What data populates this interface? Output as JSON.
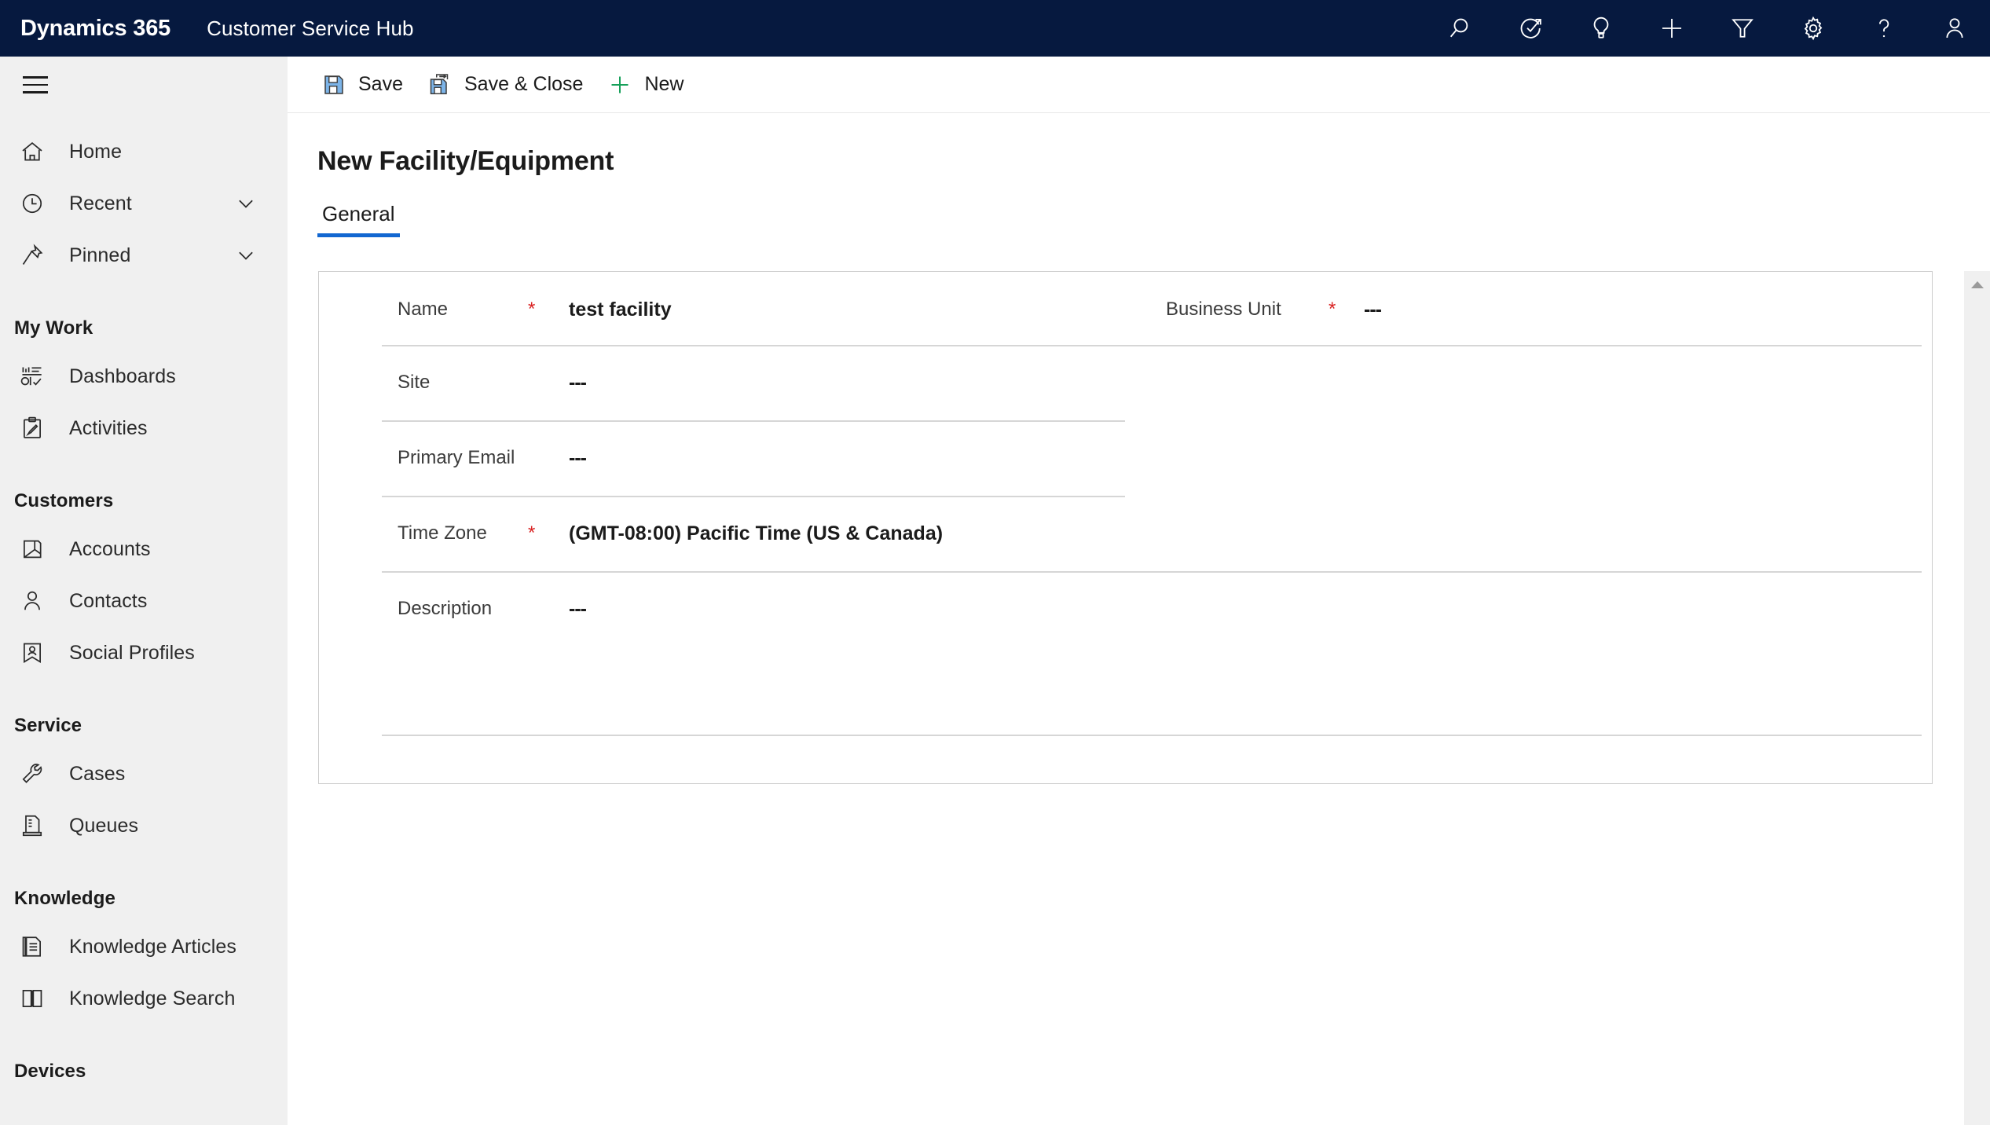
{
  "topbar": {
    "brand": "Dynamics 365",
    "app_name": "Customer Service Hub",
    "background_color": "#06193f",
    "icons": [
      {
        "name": "search-icon",
        "label": "Search"
      },
      {
        "name": "assistant-icon",
        "label": "Assistant"
      },
      {
        "name": "lightbulb-icon",
        "label": "Insights"
      },
      {
        "name": "plus-icon",
        "label": "Quick Create"
      },
      {
        "name": "filter-icon",
        "label": "Filter"
      },
      {
        "name": "gear-icon",
        "label": "Settings"
      },
      {
        "name": "help-icon",
        "label": "Help"
      },
      {
        "name": "user-icon",
        "label": "Account Manager"
      }
    ]
  },
  "sidebar": {
    "background_color": "#f0f0f0",
    "top_items": [
      {
        "label": "Home",
        "icon": "home-icon",
        "chevron": false
      },
      {
        "label": "Recent",
        "icon": "clock-icon",
        "chevron": true
      },
      {
        "label": "Pinned",
        "icon": "pin-icon",
        "chevron": true
      }
    ],
    "groups": [
      {
        "title": "My Work",
        "items": [
          {
            "label": "Dashboards",
            "icon": "dashboard-icon"
          },
          {
            "label": "Activities",
            "icon": "activities-icon"
          }
        ]
      },
      {
        "title": "Customers",
        "items": [
          {
            "label": "Accounts",
            "icon": "accounts-icon"
          },
          {
            "label": "Contacts",
            "icon": "contacts-icon"
          },
          {
            "label": "Social Profiles",
            "icon": "social-profile-icon"
          }
        ]
      },
      {
        "title": "Service",
        "items": [
          {
            "label": "Cases",
            "icon": "wrench-icon"
          },
          {
            "label": "Queues",
            "icon": "queues-icon"
          }
        ]
      },
      {
        "title": "Knowledge",
        "items": [
          {
            "label": "Knowledge Articles",
            "icon": "article-icon"
          },
          {
            "label": "Knowledge Search",
            "icon": "book-icon"
          }
        ]
      },
      {
        "title": "Devices",
        "items": []
      }
    ]
  },
  "command_bar": {
    "buttons": [
      {
        "label": "Save",
        "icon": "save-icon"
      },
      {
        "label": "Save & Close",
        "icon": "save-and-close-icon"
      },
      {
        "label": "New",
        "icon": "plus-icon"
      }
    ]
  },
  "form": {
    "title": "New Facility/Equipment",
    "tabs": [
      {
        "label": "General",
        "active": true
      }
    ],
    "accent_color": "#1267d1",
    "required_marker_color": "#d92121",
    "fields_left": [
      {
        "label": "Name",
        "required": true,
        "value": "test facility"
      },
      {
        "label": "Site",
        "required": false,
        "value": "---"
      },
      {
        "label": "Primary Email",
        "required": false,
        "value": "---"
      },
      {
        "label": "Time Zone",
        "required": true,
        "value": "(GMT-08:00) Pacific Time (US & Canada)"
      },
      {
        "label": "Description",
        "required": false,
        "value": "---"
      }
    ],
    "fields_right": [
      {
        "label": "Business Unit",
        "required": true,
        "value": "---"
      }
    ]
  },
  "scrollbar": {
    "name": "vertical-scrollbar",
    "arrow_up": "scroll-up-arrow"
  }
}
